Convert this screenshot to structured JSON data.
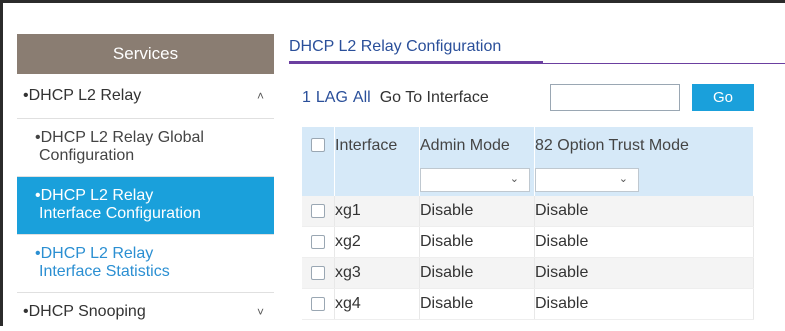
{
  "sidebar": {
    "header": "Services",
    "items": [
      {
        "label": "DHCP L2 Relay",
        "bullet": "•",
        "chevron": "˄"
      },
      {
        "label": "DHCP L2 Relay Global Configuration",
        "line1": "DHCP L2 Relay Global",
        "line2": "Configuration",
        "bullet": "•"
      },
      {
        "label": "DHCP L2 Relay Interface Configuration",
        "line1": "DHCP L2 Relay",
        "line2": "Interface Configuration",
        "bullet": "•",
        "active": true
      },
      {
        "label": "DHCP L2 Relay Interface Statistics",
        "line1": "DHCP L2 Relay",
        "line2": "Interface Statistics",
        "bullet": "•"
      },
      {
        "label": "DHCP Snooping",
        "bullet": "•",
        "chevron": "˅"
      }
    ]
  },
  "main": {
    "title": "DHCP L2 Relay Configuration",
    "filters": {
      "one": "1",
      "lag": "LAG",
      "all": "All",
      "goto_label": "Go To Interface",
      "goto_value": "",
      "go_button": "Go"
    },
    "table": {
      "columns": [
        "Interface",
        "Admin Mode",
        "82 Option Trust Mode"
      ],
      "filter_admin_mode": "",
      "filter_trust_mode": "",
      "rows": [
        {
          "interface": "xg1",
          "admin_mode": "Disable",
          "trust_mode": "Disable"
        },
        {
          "interface": "xg2",
          "admin_mode": "Disable",
          "trust_mode": "Disable"
        },
        {
          "interface": "xg3",
          "admin_mode": "Disable",
          "trust_mode": "Disable"
        },
        {
          "interface": "xg4",
          "admin_mode": "Disable",
          "trust_mode": "Disable"
        }
      ]
    }
  },
  "colors": {
    "accent": "#1aa0db",
    "sidebar_header": "#8a7d72",
    "title_underline": "#6b3fa0",
    "table_header": "#d6e9f8"
  },
  "icons": {
    "expand": "chevron-up-icon",
    "collapse": "chevron-down-icon",
    "dropdown": "chevron-down-icon",
    "checkbox": "checkbox-icon"
  }
}
